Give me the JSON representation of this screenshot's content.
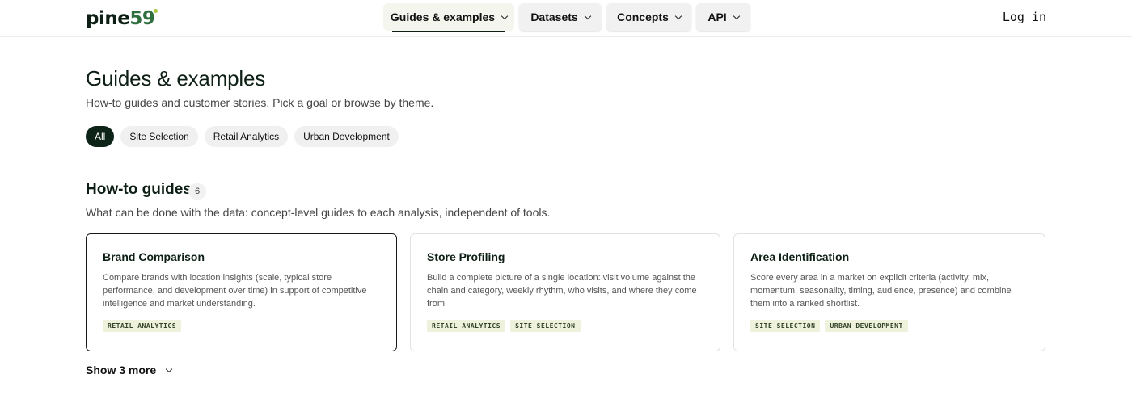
{
  "header": {
    "logo": {
      "word": "pine",
      "num": "59"
    },
    "nav": [
      {
        "label": "Guides & examples",
        "active": true
      },
      {
        "label": "Datasets",
        "active": false
      },
      {
        "label": "Concepts",
        "active": false
      },
      {
        "label": "API",
        "active": false
      }
    ],
    "login_label": "Log in"
  },
  "hero": {
    "title": "Guides & examples",
    "subtitle": "How-to guides and customer stories. Pick a goal or browse by theme."
  },
  "filters": [
    {
      "label": "All",
      "active": true
    },
    {
      "label": "Site Selection",
      "active": false
    },
    {
      "label": "Retail Analytics",
      "active": false
    },
    {
      "label": "Urban Development",
      "active": false
    }
  ],
  "section": {
    "title": "How-to guides",
    "count": "6",
    "description": "What can be done with the data: concept-level guides to each analysis, independent of tools."
  },
  "cards": [
    {
      "title": "Brand Comparison",
      "description": "Compare brands with location insights (scale, typical store performance, and development over time) in support of competitive intelligence and market understanding.",
      "tags": [
        "RETAIL ANALYTICS"
      ],
      "selected": true
    },
    {
      "title": "Store Profiling",
      "description": "Build a complete picture of a single location: visit volume against the chain and category, weekly rhythm, who visits, and where they come from.",
      "tags": [
        "RETAIL ANALYTICS",
        "SITE SELECTION"
      ],
      "selected": false
    },
    {
      "title": "Area Identification",
      "description": "Score every area in a market on explicit criteria (activity, mix, momentum, seasonality, timing, audience, presence) and combine them into a ranked shortlist.",
      "tags": [
        "SITE SELECTION",
        "URBAN DEVELOPMENT"
      ],
      "selected": false
    }
  ],
  "show_more_label": "Show 3 more",
  "icons": {
    "nav_dropdown": "chevron-down-icon",
    "show_more": "chevron-down-icon"
  },
  "colors": {
    "brand_dark": "#0d2318",
    "brand_green": "#2f6f3e",
    "logo_accent": "#a8c63a",
    "tag_bg": "#eef2dc"
  }
}
